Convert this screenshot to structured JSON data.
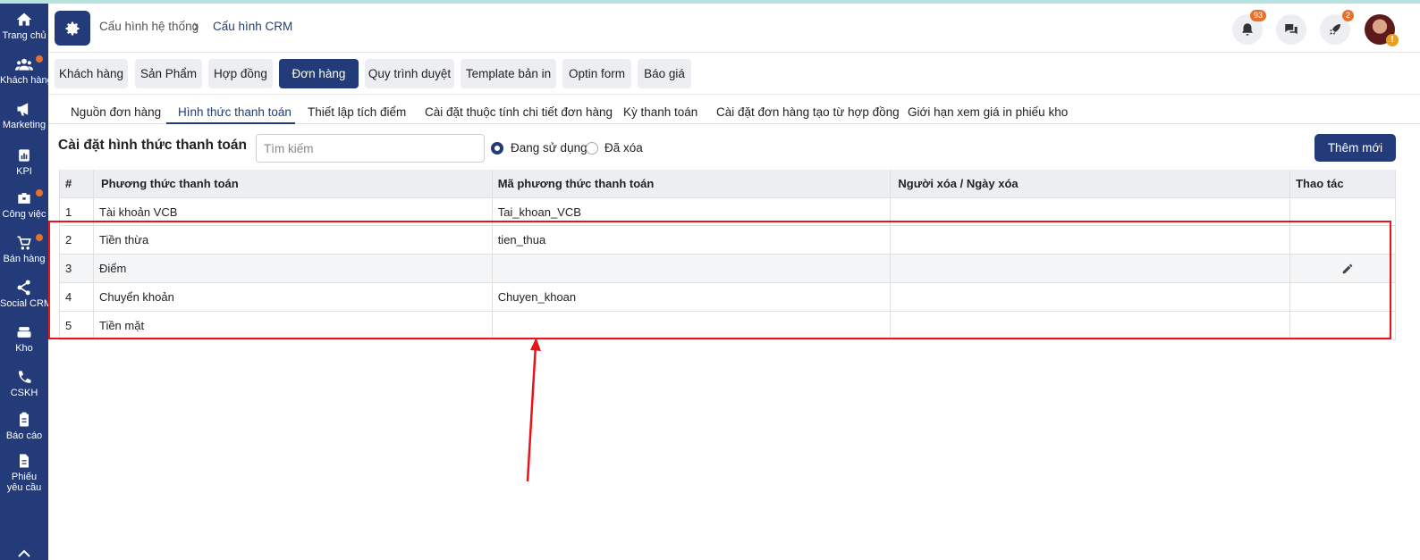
{
  "sidebar": {
    "items": [
      {
        "label": "Trang chủ",
        "icon": "home-icon",
        "dot": false
      },
      {
        "label": "Khách hàng",
        "icon": "users-icon",
        "dot": true
      },
      {
        "label": "Marketing",
        "icon": "megaphone-icon",
        "dot": false
      },
      {
        "label": "KPI",
        "icon": "chart-icon",
        "dot": false
      },
      {
        "label": "Công việc",
        "icon": "briefcase-icon",
        "dot": true
      },
      {
        "label": "Bán hàng",
        "icon": "cart-icon",
        "dot": true
      },
      {
        "label": "Social CRM",
        "icon": "share-icon",
        "dot": false
      },
      {
        "label": "Kho",
        "icon": "warehouse-icon",
        "dot": false
      },
      {
        "label": "CSKH",
        "icon": "phone-icon",
        "dot": false
      },
      {
        "label": "Báo cáo",
        "icon": "clipboard-icon",
        "dot": false
      },
      {
        "label": "Phiếu yêu cầu",
        "icon": "document-icon",
        "dot": false
      }
    ]
  },
  "header": {
    "breadcrumb": [
      "Cấu hình hệ thống",
      "Cấu hình CRM"
    ],
    "notifications_count": "93",
    "rocket_count": "2"
  },
  "module_tabs": [
    "Khách hàng",
    "Sản Phẩm",
    "Hợp đồng",
    "Đơn hàng",
    "Quy trình duyệt",
    "Template bản in",
    "Optin form",
    "Báo giá"
  ],
  "module_tab_active": "Đơn hàng",
  "sub_tabs": [
    "Nguồn đơn hàng",
    "Hình thức thanh toán",
    "Thiết lập tích điểm",
    "Cài đặt thuộc tính chi tiết đơn hàng",
    "Kỳ thanh toán",
    "Cài đặt đơn hàng tạo từ hợp đồng",
    "Giới hạn xem giá in phiếu kho"
  ],
  "sub_tab_active": "Hình thức thanh toán",
  "page": {
    "title": "Cài đặt hình thức thanh toán",
    "search_placeholder": "Tìm kiếm",
    "filter_active": "Đang sử dụng",
    "filter_deleted": "Đã xóa",
    "add_button": "Thêm mới"
  },
  "table": {
    "columns": [
      "#",
      "Phương thức thanh toán",
      "Mã phương thức thanh toán",
      "Người xóa / Ngày xóa",
      "Thao tác"
    ],
    "rows": [
      [
        "1",
        "Tài khoản VCB",
        "Tai_khoan_VCB",
        "",
        ""
      ],
      [
        "2",
        "Tiền thừa",
        "tien_thua",
        "",
        ""
      ],
      [
        "3",
        "Điểm",
        "",
        "",
        ""
      ],
      [
        "4",
        "Chuyển khoản",
        "Chuyen_khoan",
        "",
        ""
      ],
      [
        "5",
        "Tiền mặt",
        "",
        "",
        ""
      ]
    ]
  },
  "colors": {
    "primary": "#243b7a",
    "accent": "#e8702a",
    "annotation": "#e8141b"
  }
}
